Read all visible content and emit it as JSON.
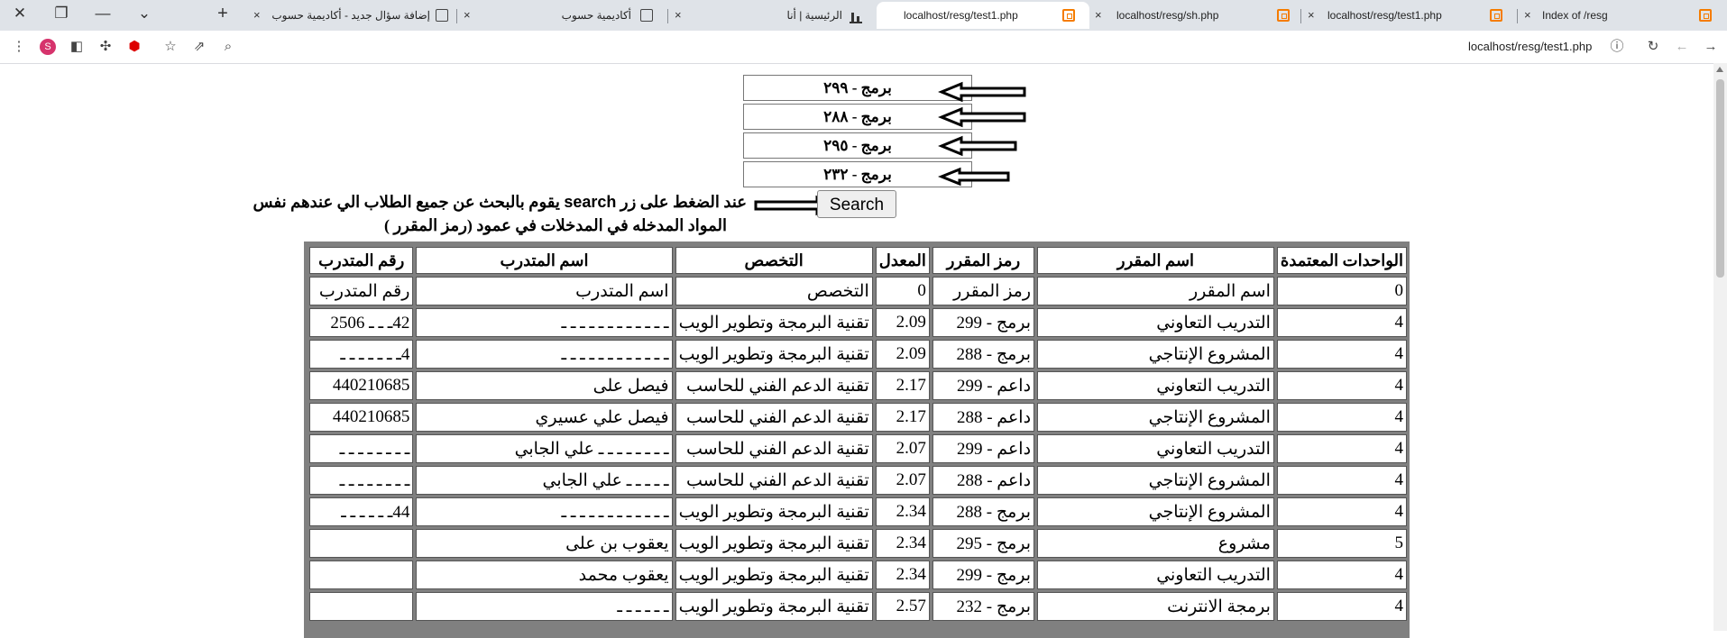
{
  "browser": {
    "tabs": [
      {
        "title": "Index of /resg",
        "icon": "xampp-icon"
      },
      {
        "title": "localhost/resg/test1.php",
        "icon": "xampp-icon"
      },
      {
        "title": "localhost/resg/sh.php",
        "icon": "xampp-icon"
      },
      {
        "title": "localhost/resg/test1.php",
        "icon": "xampp-icon",
        "active": true
      },
      {
        "title": "الرئيسية | أنا",
        "icon": "bars-icon"
      },
      {
        "title": "أكاديمية حسوب",
        "icon": "file-icon"
      },
      {
        "title": "إضافة سؤال جديد - أكاديمية حسوب",
        "icon": "file-icon"
      }
    ],
    "close_glyph": "×",
    "new_tab_glyph": "+",
    "address": "localhost/resg/test1.php",
    "avatar_letter": "S"
  },
  "courses": [
    "برمج - ٢٩٩",
    "برمج - ٢٨٨",
    "برمج - ٢٩٥",
    "برمج - ٢٣٢"
  ],
  "search_button": "Search",
  "note": {
    "line1_a": "عند الضغط على زر ",
    "line1_b": "search",
    "line1_c": " يقوم بالبحث عن جميع الطلاب الي عندهم نفس",
    "line2": "المواد المدخله في المدخلات  في عمود (رمز المقرر )"
  },
  "table": {
    "headers": [
      "الواحدات المعتمدة",
      "اسم المقرر",
      "رمز المقرر",
      "المعدل",
      "التخصص",
      "اسم المتدرب",
      "رقم المتدرب"
    ],
    "rows": [
      [
        "0",
        "اسم المقرر",
        "رمز المقرر",
        "0",
        "التخصص",
        "اسم المتدرب",
        "رقم المتدرب"
      ],
      [
        "4",
        "التدريب التعاوني",
        "برمج - 299",
        "2.09",
        "تقنية البرمجة وتطوير الويب",
        "ـ ـ ـ ـ ـ ـ ـ ـ ـ ـ ـ ـ",
        "42‍ـ ـ ـ 2506"
      ],
      [
        "4",
        "المشروع الإنتاجي",
        "برمج - 288",
        "2.09",
        "تقنية البرمجة وتطوير الويب",
        "ـ ـ ـ ـ ـ ـ ـ ـ ـ ـ ـ ـ",
        "4ـ ـ ـ ـ ـ ـ ـ"
      ],
      [
        "4",
        "التدريب التعاوني",
        "داعم - 299",
        "2.17",
        "تقنية الدعم الفني للحاسب",
        "فيصل على",
        "440210685"
      ],
      [
        "4",
        "المشروع الإنتاجي",
        "داعم - 288",
        "2.17",
        "تقنية الدعم الفني للحاسب",
        "فيصل علي عسيري",
        "440210685"
      ],
      [
        "4",
        "التدريب التعاوني",
        "داعم - 299",
        "2.07",
        "تقنية الدعم الفني للحاسب",
        "ـ ـ ـ ـ ـ ـ ـ ـ علي الجابي",
        "ـ ـ ـ ـ ـ ـ ـ ـ"
      ],
      [
        "4",
        "المشروع الإنتاجي",
        "داعم - 288",
        "2.07",
        "تقنية الدعم الفني للحاسب",
        "ـ ـ ـ ـ ـ علي الجابي",
        "ـ ـ ـ ـ ـ ـ ـ ـ"
      ],
      [
        "4",
        "المشروع الإنتاجي",
        "برمج - 288",
        "2.34",
        "تقنية البرمجة وتطوير الويب",
        "ـ ـ ـ ـ ـ ـ ـ ـ ـ ـ ـ ـ",
        "44ـ ـ ـ ـ ـ ـ"
      ],
      [
        "5",
        "مشروع",
        "برمج - 295",
        "2.34",
        "تقنية البرمجة وتطوير الويب",
        "يعقوب بن على",
        ""
      ],
      [
        "4",
        "التدريب التعاوني",
        "برمج - 299",
        "2.34",
        "تقنية البرمجة وتطوير الويب",
        "يعقوب محمد",
        ""
      ],
      [
        "4",
        "برمجة الانترنت",
        "برمج - 232",
        "2.57",
        "تقنية البرمجة وتطوير الويب",
        "ـ ـ ـ ـ ـ ـ",
        ""
      ]
    ]
  }
}
